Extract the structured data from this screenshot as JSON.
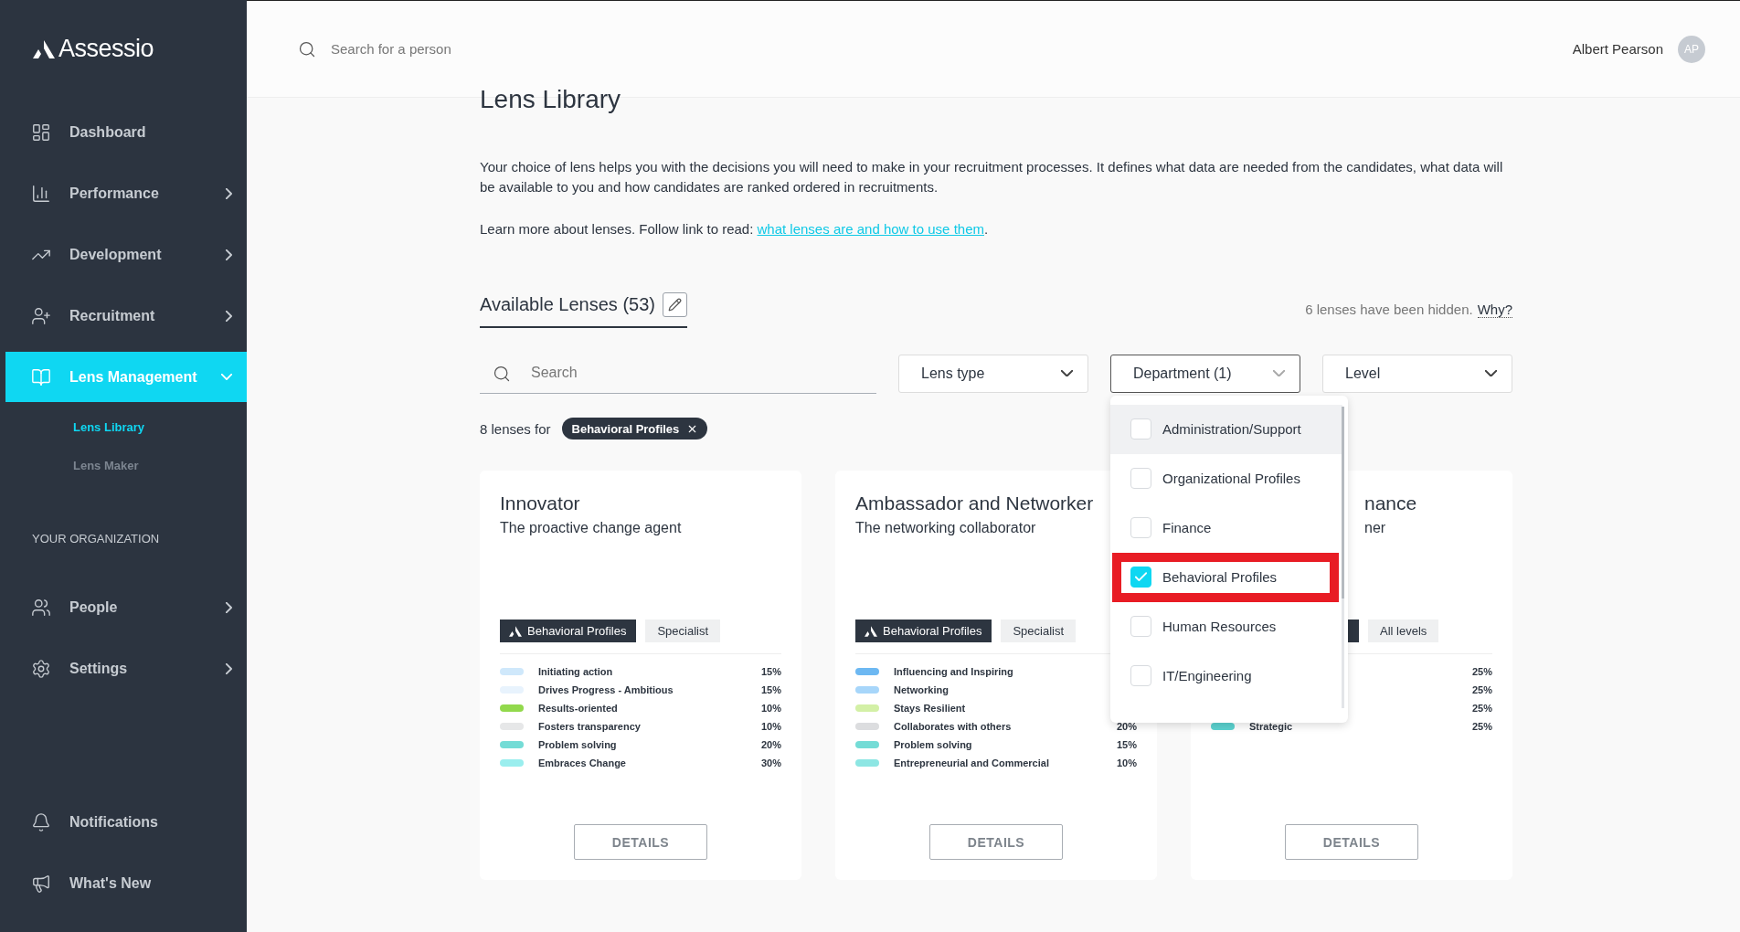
{
  "sidebar": {
    "logo": "Assessio",
    "items": [
      {
        "label": "Dashboard",
        "selected": false
      },
      {
        "label": "Performance",
        "selected": false,
        "expanded": false
      },
      {
        "label": "Development",
        "selected": false,
        "expanded": false
      },
      {
        "label": "Recruitment",
        "selected": false,
        "expanded": false
      },
      {
        "label": "Lens Management",
        "selected": true,
        "expanded": true,
        "children": [
          {
            "label": "Lens Library",
            "selected": true
          },
          {
            "label": "Lens Maker",
            "selected": false
          }
        ]
      }
    ],
    "section_label": "YOUR ORGANIZATION",
    "org_items": [
      {
        "label": "People",
        "selected": false,
        "expanded": false
      },
      {
        "label": "Settings",
        "selected": false,
        "expanded": false
      }
    ],
    "bottom_items": [
      {
        "label": "Notifications"
      },
      {
        "label": "What's New"
      }
    ]
  },
  "header": {
    "search": {
      "placeholder": "Search for a person"
    },
    "user": {
      "name": "Albert Pearson",
      "initials": "AP"
    }
  },
  "page": {
    "title": "Lens Library",
    "intro": "Your choice of lens helps you with the decisions you will need to make in your recruitment processes. It defines what data are needed from the candidates, what data will be available to you and how candidates are ranked ordered in recruitments.",
    "learn_more": {
      "text": "Learn more about lenses. Follow link to read: ",
      "link": "what lenses are and how to use them",
      "end": "."
    },
    "tab": {
      "label": "Available Lenses (53)",
      "selected": true
    },
    "hidden_note": {
      "text": "6 lenses have been hidden.",
      "link": "Why?"
    },
    "search": {
      "placeholder": "Search"
    },
    "filters": [
      {
        "label": "Lens type",
        "open": false
      },
      {
        "label": "Department (1)",
        "open": true
      },
      {
        "label": "Level",
        "open": false
      }
    ],
    "result_count": "8 lenses for",
    "active_chips": [
      "Behavioral Profiles"
    ],
    "department_options": [
      {
        "label": "Administration/Support",
        "checked": false,
        "hovered": true,
        "highlighted": false
      },
      {
        "label": "Organizational Profiles",
        "checked": false,
        "hovered": false,
        "highlighted": false
      },
      {
        "label": "Finance",
        "checked": false,
        "hovered": false,
        "highlighted": false
      },
      {
        "label": "Behavioral Profiles",
        "checked": true,
        "hovered": false,
        "highlighted": true
      },
      {
        "label": "Human Resources",
        "checked": false,
        "hovered": false,
        "highlighted": false
      },
      {
        "label": "IT/Engineering",
        "checked": false,
        "hovered": false,
        "highlighted": false
      }
    ],
    "cards": [
      {
        "kind": "full",
        "title": "Innovator",
        "subtitle": "The proactive change agent",
        "type_tag": "Behavioral Profiles",
        "level_tag": "Specialist",
        "button": "DETAILS",
        "traits": [
          {
            "label": "Initiating action",
            "value": "15%",
            "color": "#cfe8fb"
          },
          {
            "label": "Drives Progress - Ambitious",
            "value": "15%",
            "color": "#e8f3fd"
          },
          {
            "label": "Results-oriented",
            "value": "10%",
            "color": "#92d94c"
          },
          {
            "label": "Fosters transparency",
            "value": "10%",
            "color": "#e6e7e8"
          },
          {
            "label": "Problem solving",
            "value": "20%",
            "color": "#74dcd6"
          },
          {
            "label": "Embraces Change",
            "value": "30%",
            "color": "#9aeeee"
          }
        ]
      },
      {
        "kind": "full",
        "title": "Ambassador and Networker",
        "subtitle": "The networking collaborator",
        "type_tag": "Behavioral Profiles",
        "level_tag": "Specialist",
        "button": "DETAILS",
        "traits": [
          {
            "label": "Influencing and Inspiring",
            "color": "#6db8f2"
          },
          {
            "label": "Networking",
            "color": "#a7d6fa"
          },
          {
            "label": "Stays Resilient",
            "color": "#d3f0a6"
          },
          {
            "label": "Collaborates with others",
            "value": "20%",
            "color": "#dcdddf"
          },
          {
            "label": "Problem solving",
            "value": "15%",
            "color": "#74dcd6"
          },
          {
            "label": "Entrepreneurial and Commercial",
            "value": "10%",
            "color": "#8de6e3"
          }
        ]
      },
      {
        "kind": "partial",
        "title": "nance",
        "subtitle": "ner",
        "level_tag": "All levels",
        "button": "DETAILS",
        "traits": [
          {
            "value": "25%"
          },
          {
            "value": "25%"
          },
          {
            "value": "25%"
          },
          {
            "label": "Strategic",
            "value": "25%",
            "color": "#5bd3d0"
          }
        ]
      }
    ]
  }
}
